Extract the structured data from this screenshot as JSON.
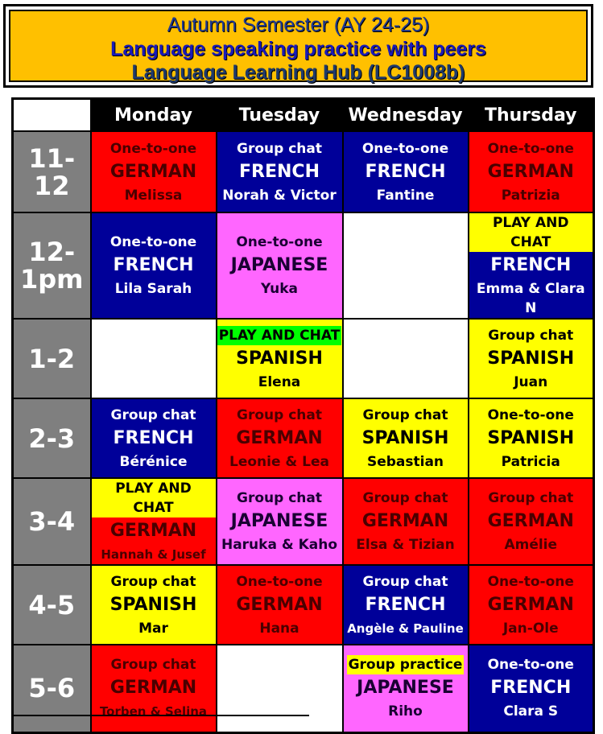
{
  "banner": {
    "line1": "Autumn Semester (AY 24-25)",
    "line2": "Language speaking practice with peers",
    "line3": "Language Learning Hub (LC1008b)",
    "background": "#FFC000"
  },
  "colors": {
    "german": "#FF0000",
    "french": "#000099",
    "spanish": "#FFFF00",
    "japanese": "#FF66FF",
    "time_column": "#7F7F7F",
    "play_and_chat_highlight_yellow": "#FFFF00",
    "play_and_chat_highlight_green": "#00FF00"
  },
  "days": [
    "Monday",
    "Tuesday",
    "Wednesday",
    "Thursday"
  ],
  "rows": [
    {
      "time": "11-12",
      "cells": [
        {
          "type": "One-to-one",
          "language": "GERMAN",
          "tutor": "Melissa",
          "color": "red"
        },
        {
          "type": "Group chat",
          "language": "FRENCH",
          "tutor": "Norah & Victor",
          "color": "blue"
        },
        {
          "type": "One-to-one",
          "language": "FRENCH",
          "tutor": "Fantine",
          "color": "blue"
        },
        {
          "type": "One-to-one",
          "language": "GERMAN",
          "tutor": "Patrizia",
          "color": "red"
        }
      ]
    },
    {
      "time": "12-\n1pm",
      "cells": [
        {
          "type": "One-to-one",
          "language": "FRENCH",
          "tutor": "Lila Sarah",
          "color": "blue"
        },
        {
          "type": "One-to-one",
          "language": "JAPANESE",
          "tutor": "Yuka",
          "color": "pink"
        },
        {
          "type": "",
          "language": "",
          "tutor": "",
          "color": "empty"
        },
        {
          "type": "PLAY AND CHAT",
          "language": "FRENCH",
          "tutor": "Emma & Clara N",
          "color": "blue",
          "highlight": "yellow"
        }
      ]
    },
    {
      "time": "1-2",
      "cells": [
        {
          "type": "",
          "language": "",
          "tutor": "",
          "color": "empty"
        },
        {
          "type": "PLAY AND CHAT",
          "language": "SPANISH",
          "tutor": "Elena",
          "color": "yellow",
          "highlight": "green"
        },
        {
          "type": "",
          "language": "",
          "tutor": "",
          "color": "empty"
        },
        {
          "type": "Group chat",
          "language": "SPANISH",
          "tutor": "Juan",
          "color": "yellow"
        }
      ]
    },
    {
      "time": "2-3",
      "cells": [
        {
          "type": "Group chat",
          "language": "FRENCH",
          "tutor": "Bérénice",
          "color": "blue"
        },
        {
          "type": "Group chat",
          "language": "GERMAN",
          "tutor": "Leonie & Lea",
          "color": "red"
        },
        {
          "type": "Group chat",
          "language": "SPANISH",
          "tutor": "Sebastian",
          "color": "yellow"
        },
        {
          "type": "One-to-one",
          "language": "SPANISH",
          "tutor": "Patricia",
          "color": "yellow"
        }
      ]
    },
    {
      "time": "3-4",
      "cells": [
        {
          "type": "PLAY AND CHAT",
          "language": "GERMAN",
          "tutor": "Hannah  & Jusef",
          "color": "red",
          "highlight": "yellow"
        },
        {
          "type": "Group chat",
          "language": "JAPANESE",
          "tutor": "Haruka & Kaho",
          "color": "pink"
        },
        {
          "type": "Group chat",
          "language": "GERMAN",
          "tutor": "Elsa & Tizian",
          "color": "red"
        },
        {
          "type": "Group chat",
          "language": "GERMAN",
          "tutor": "Amélie",
          "color": "red"
        }
      ]
    },
    {
      "time": "4-5",
      "cells": [
        {
          "type": "Group chat",
          "language": "SPANISH",
          "tutor": "Mar",
          "color": "yellow"
        },
        {
          "type": "One-to-one",
          "language": "GERMAN",
          "tutor": "Hana",
          "color": "red"
        },
        {
          "type": "Group chat",
          "language": "FRENCH",
          "tutor": "Angèle & Pauline",
          "color": "blue"
        },
        {
          "type": "One-to-one",
          "language": "GERMAN",
          "tutor": "Jan-Ole",
          "color": "red"
        }
      ]
    },
    {
      "time": "5-6",
      "cells": [
        {
          "type": "Group chat",
          "language": "GERMAN",
          "tutor": "Torben & Selina",
          "color": "red"
        },
        {
          "type": "",
          "language": "",
          "tutor": "",
          "color": "empty"
        },
        {
          "type": "Group practice",
          "language": "JAPANESE",
          "tutor": "Riho",
          "color": "pink",
          "highlight": "yellow"
        },
        {
          "type": "One-to-one",
          "language": "FRENCH",
          "tutor": "Clara S",
          "color": "blue"
        }
      ]
    }
  ]
}
